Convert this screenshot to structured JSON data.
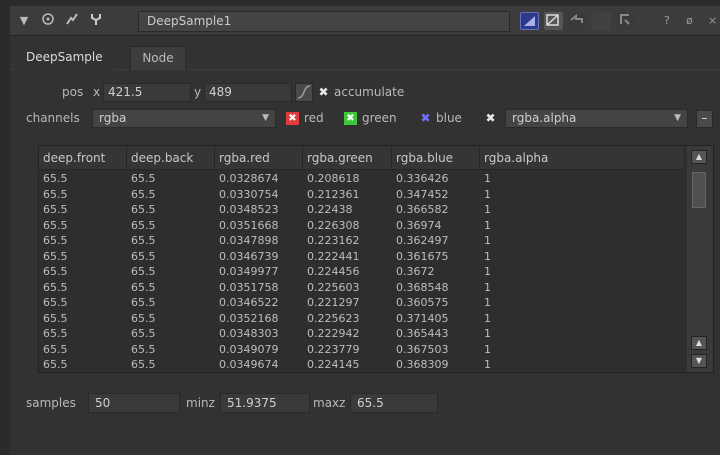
{
  "window": {
    "node_name": "DeepSample1",
    "help_label": "?",
    "float_label": "ø",
    "close_label": "×"
  },
  "tabs": [
    {
      "label": "DeepSample",
      "active": true
    },
    {
      "label": "Node",
      "active": false
    }
  ],
  "pos": {
    "label": "pos",
    "x_label": "x",
    "x_value": "421.5",
    "y_label": "y",
    "y_value": "489",
    "accumulate_label": "accumulate",
    "accumulate_checked": true
  },
  "channels": {
    "label": "channels",
    "value": "rgba",
    "red_label": "red",
    "green_label": "green",
    "blue_label": "blue",
    "alpha_dropdown": "rgba.alpha",
    "minus_label": "–",
    "colors": {
      "red": "#e03c3c",
      "green": "#3cc83c",
      "blue": "#4646e6"
    }
  },
  "table": {
    "columns": [
      "deep.front",
      "deep.back",
      "rgba.red",
      "rgba.green",
      "rgba.blue",
      "rgba.alpha"
    ],
    "rows": [
      [
        "65.5",
        "65.5",
        "0.0328674",
        "0.208618",
        "0.336426",
        "1"
      ],
      [
        "65.5",
        "65.5",
        "0.0330754",
        "0.212361",
        "0.347452",
        "1"
      ],
      [
        "65.5",
        "65.5",
        "0.0348523",
        "0.22438",
        "0.366582",
        "1"
      ],
      [
        "65.5",
        "65.5",
        "0.0351668",
        "0.226308",
        "0.36974",
        "1"
      ],
      [
        "65.5",
        "65.5",
        "0.0347898",
        "0.223162",
        "0.362497",
        "1"
      ],
      [
        "65.5",
        "65.5",
        "0.0346739",
        "0.222441",
        "0.361675",
        "1"
      ],
      [
        "65.5",
        "65.5",
        "0.0349977",
        "0.224456",
        "0.3672",
        "1"
      ],
      [
        "65.5",
        "65.5",
        "0.0351758",
        "0.225603",
        "0.368548",
        "1"
      ],
      [
        "65.5",
        "65.5",
        "0.0346522",
        "0.221297",
        "0.360575",
        "1"
      ],
      [
        "65.5",
        "65.5",
        "0.0352168",
        "0.225623",
        "0.371405",
        "1"
      ],
      [
        "65.5",
        "65.5",
        "0.0348303",
        "0.222942",
        "0.365443",
        "1"
      ],
      [
        "65.5",
        "65.5",
        "0.0349079",
        "0.223779",
        "0.367503",
        "1"
      ],
      [
        "65.5",
        "65.5",
        "0.0349674",
        "0.224145",
        "0.368309",
        "1"
      ]
    ]
  },
  "stats": {
    "samples_label": "samples",
    "samples_value": "50",
    "minz_label": "minz",
    "minz_value": "51.9375",
    "maxz_label": "maxz",
    "maxz_value": "65.5"
  }
}
